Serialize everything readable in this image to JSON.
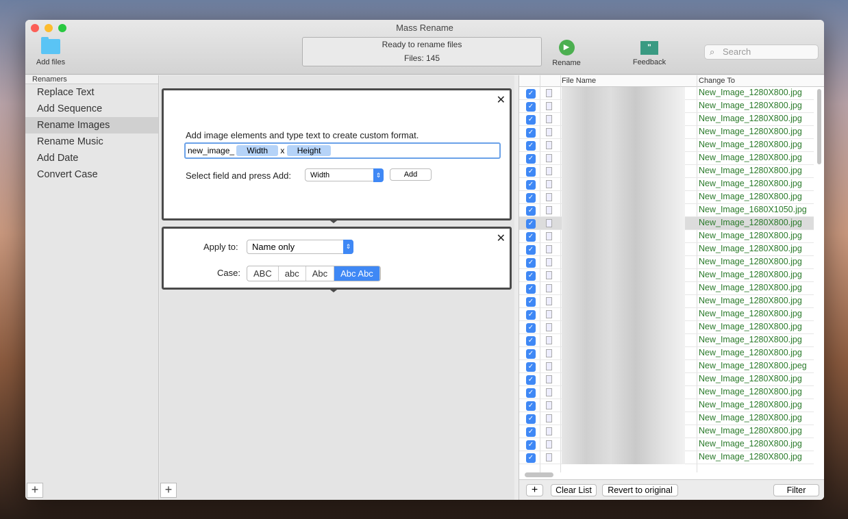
{
  "window": {
    "title": "Mass Rename"
  },
  "toolbar": {
    "add_files": "Add files",
    "status_line1": "Ready to rename files",
    "status_line2": "Files: 145",
    "rename": "Rename",
    "feedback": "Feedback",
    "search_placeholder": "Search"
  },
  "sidebar": {
    "header": "Renamers",
    "items": [
      "Replace Text",
      "Add Sequence",
      "Rename Images",
      "Rename Music",
      "Add Date",
      "Convert Case"
    ],
    "selected": 2
  },
  "image_panel": {
    "instruction": "Add image elements and type text to create custom format.",
    "prefix": "new_image_",
    "token1": "Width",
    "separator": "x",
    "token2": "Height",
    "select_label": "Select field and press Add:",
    "select_value": "Width",
    "add_button": "Add"
  },
  "case_panel": {
    "apply_label": "Apply to:",
    "apply_value": "Name only",
    "case_label": "Case:",
    "case_options": [
      "ABC",
      "abc",
      "Abc",
      "Abc Abc"
    ],
    "case_selected": 3
  },
  "file_list": {
    "col_name": "File Name",
    "col_change": "Change To",
    "selected_row": 10,
    "rows": [
      "New_Image_1280X800.jpg",
      "New_Image_1280X800.jpg",
      "New_Image_1280X800.jpg",
      "New_Image_1280X800.jpg",
      "New_Image_1280X800.jpg",
      "New_Image_1280X800.jpg",
      "New_Image_1280X800.jpg",
      "New_Image_1280X800.jpg",
      "New_Image_1280X800.jpg",
      "New_Image_1680X1050.jpg",
      "New_Image_1280X800.jpg",
      "New_Image_1280X800.jpg",
      "New_Image_1280X800.jpg",
      "New_Image_1280X800.jpg",
      "New_Image_1280X800.jpg",
      "New_Image_1280X800.jpg",
      "New_Image_1280X800.jpg",
      "New_Image_1280X800.jpg",
      "New_Image_1280X800.jpg",
      "New_Image_1280X800.jpg",
      "New_Image_1280X800.jpg",
      "New_Image_1280X800.jpeg",
      "New_Image_1280X800.jpg",
      "New_Image_1280X800.jpg",
      "New_Image_1280X800.jpg",
      "New_Image_1280X800.jpg",
      "New_Image_1280X800.jpg",
      "New_Image_1280X800.jpg",
      "New_Image_1280X800.jpg"
    ]
  },
  "bottom": {
    "clear_list": "Clear List",
    "revert": "Revert to original",
    "filter": "Filter",
    "plus": "+"
  }
}
